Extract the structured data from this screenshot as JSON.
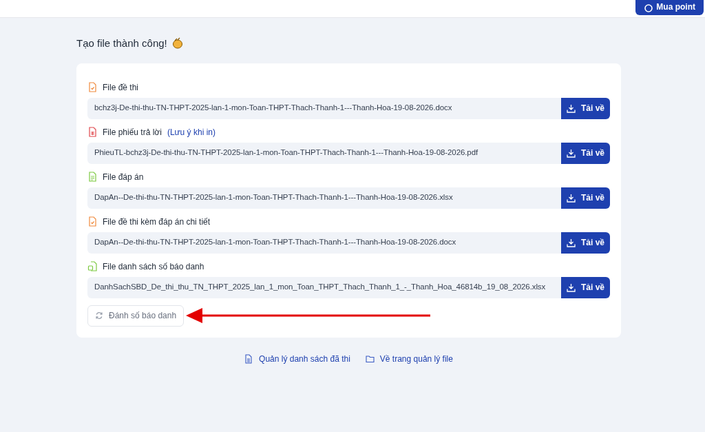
{
  "header": {
    "button": "Mua point"
  },
  "title": "Tạo file thành công!",
  "files": [
    {
      "kind": "exam",
      "label": "File đề thi",
      "filename": "bchz3j-De-thi-thu-TN-THPT-2025-lan-1-mon-Toan-THPT-Thach-Thanh-1---Thanh-Hoa-19-08-2026.docx",
      "button": "Tải về"
    },
    {
      "kind": "answer-sheet",
      "label": "File phiếu trả lời",
      "hint": "(Lưu ý khi in)",
      "filename": "PhieuTL-bchz3j-De-thi-thu-TN-THPT-2025-lan-1-mon-Toan-THPT-Thach-Thanh-1---Thanh-Hoa-19-08-2026.pdf",
      "button": "Tải về"
    },
    {
      "kind": "key",
      "label": "File đáp án",
      "filename": "DapAn--De-thi-thu-TN-THPT-2025-lan-1-mon-Toan-THPT-Thach-Thanh-1---Thanh-Hoa-19-08-2026.xlsx",
      "button": "Tải về"
    },
    {
      "kind": "exam",
      "label": "File đề thi kèm đáp án chi tiết",
      "filename": "DapAn--De-thi-thu-TN-THPT-2025-lan-1-mon-Toan-THPT-Thach-Thanh-1---Thanh-Hoa-19-08-2026.docx",
      "button": "Tải về"
    },
    {
      "kind": "roster",
      "label": "File danh sách số báo danh",
      "filename": "DanhSachSBD_De_thi_thu_TN_THPT_2025_lan_1_mon_Toan_THPT_Thach_Thanh_1_-_Thanh_Hoa_46814b_19_08_2026.xlsx",
      "button": "Tải về"
    }
  ],
  "number_button": "Đánh số báo danh",
  "pointer_arrow": true,
  "links": [
    {
      "kind": "list",
      "label": "Quản lý danh sách đã thi"
    },
    {
      "kind": "folder",
      "label": "Về trang quản lý file"
    }
  ]
}
